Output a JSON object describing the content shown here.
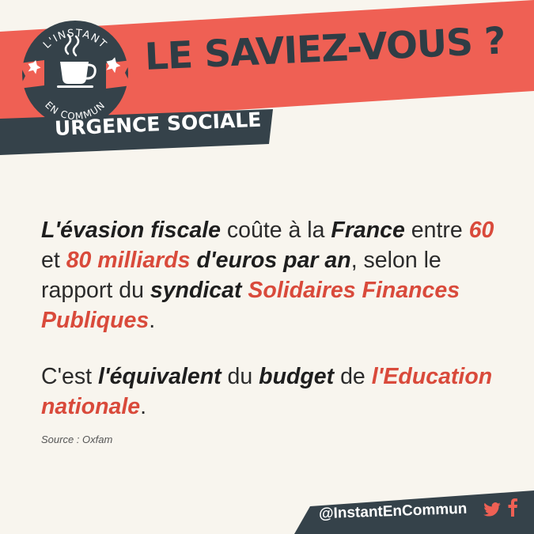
{
  "logo": {
    "top_text": "L'INSTANT",
    "bottom_text": "EN COMMUN",
    "icon": "coffee-cup-icon"
  },
  "header": {
    "title": "LE SAVIEZ-VOUS ?",
    "category": "URGENCE SOCIALE"
  },
  "body": {
    "p1": {
      "s1": "L'évasion fiscale",
      "s2": " coûte à la ",
      "s3": "France",
      "s4": " entre ",
      "s5": "60",
      "s6": " et ",
      "s7": "80 milliards",
      "s8": " ",
      "s9": "d'euros par an",
      "s10": ", selon le rapport du ",
      "s11": "syndicat",
      "s12": " ",
      "s13": "Solidaires Finances Publiques",
      "s14": "."
    },
    "p2": {
      "s1": "C'est ",
      "s2": "l'équivalent",
      "s3": " du ",
      "s4": "budget",
      "s5": " de ",
      "s6": "l'Education nationale",
      "s7": "."
    }
  },
  "source": "Source : Oxfam",
  "footer": {
    "handle": "@InstantEnCommun",
    "icons": [
      "twitter-icon",
      "facebook-icon"
    ]
  },
  "colors": {
    "accent_red": "#ef6054",
    "dark_slate": "#35424a",
    "text_red": "#d94a3b",
    "background": "#f8f5ee"
  }
}
